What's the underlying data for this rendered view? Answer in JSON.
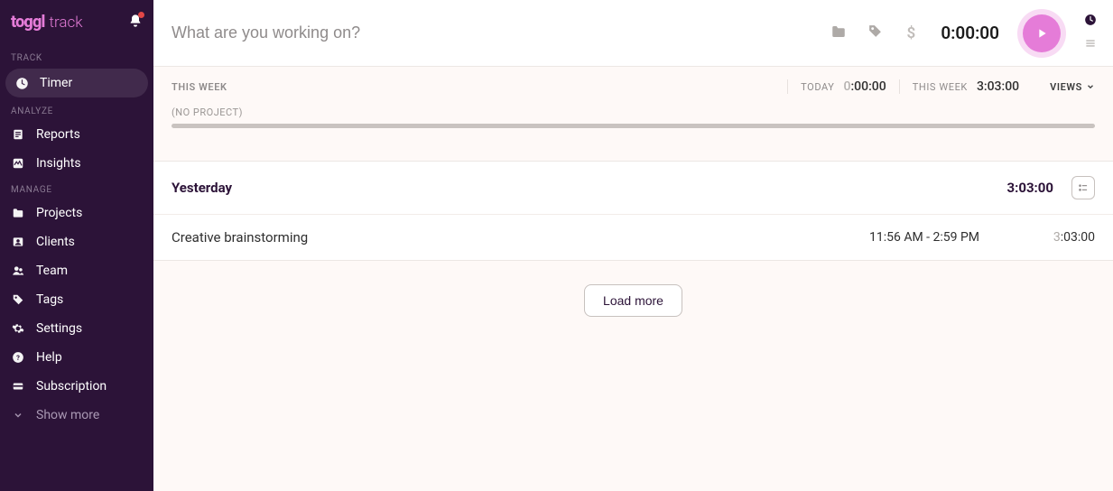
{
  "brand": {
    "bold": "toggl",
    "light": "track"
  },
  "sidebar": {
    "sections": [
      {
        "label": "TRACK",
        "items": [
          {
            "id": "timer",
            "label": "Timer",
            "icon": "clock",
            "active": true
          }
        ]
      },
      {
        "label": "ANALYZE",
        "items": [
          {
            "id": "reports",
            "label": "Reports",
            "icon": "doc"
          },
          {
            "id": "insights",
            "label": "Insights",
            "icon": "waveform-box"
          }
        ]
      },
      {
        "label": "MANAGE",
        "items": [
          {
            "id": "projects",
            "label": "Projects",
            "icon": "folder"
          },
          {
            "id": "clients",
            "label": "Clients",
            "icon": "person-card"
          },
          {
            "id": "team",
            "label": "Team",
            "icon": "people"
          },
          {
            "id": "tags",
            "label": "Tags",
            "icon": "tag"
          },
          {
            "id": "settings",
            "label": "Settings",
            "icon": "gear"
          },
          {
            "id": "help",
            "label": "Help",
            "icon": "help"
          },
          {
            "id": "subscription",
            "label": "Subscription",
            "icon": "card"
          }
        ]
      }
    ],
    "show_more_label": "Show more"
  },
  "timer": {
    "placeholder": "What are you working on?",
    "value": "0:00:00"
  },
  "summary": {
    "main_label": "THIS WEEK",
    "today_label": "TODAY",
    "today_value": "0:00:00",
    "this_week_label": "THIS WEEK",
    "this_week_value": "3:03:00",
    "views_label": "VIEWS"
  },
  "noproject": {
    "label": "(NO PROJECT)"
  },
  "day": {
    "title": "Yesterday",
    "total": "3:03:00",
    "entries": [
      {
        "title": "Creative brainstorming",
        "range": "11:56 AM - 2:59 PM",
        "dur_prefix": "3",
        "dur_rest": ":03:00"
      }
    ]
  },
  "load_more": "Load more"
}
